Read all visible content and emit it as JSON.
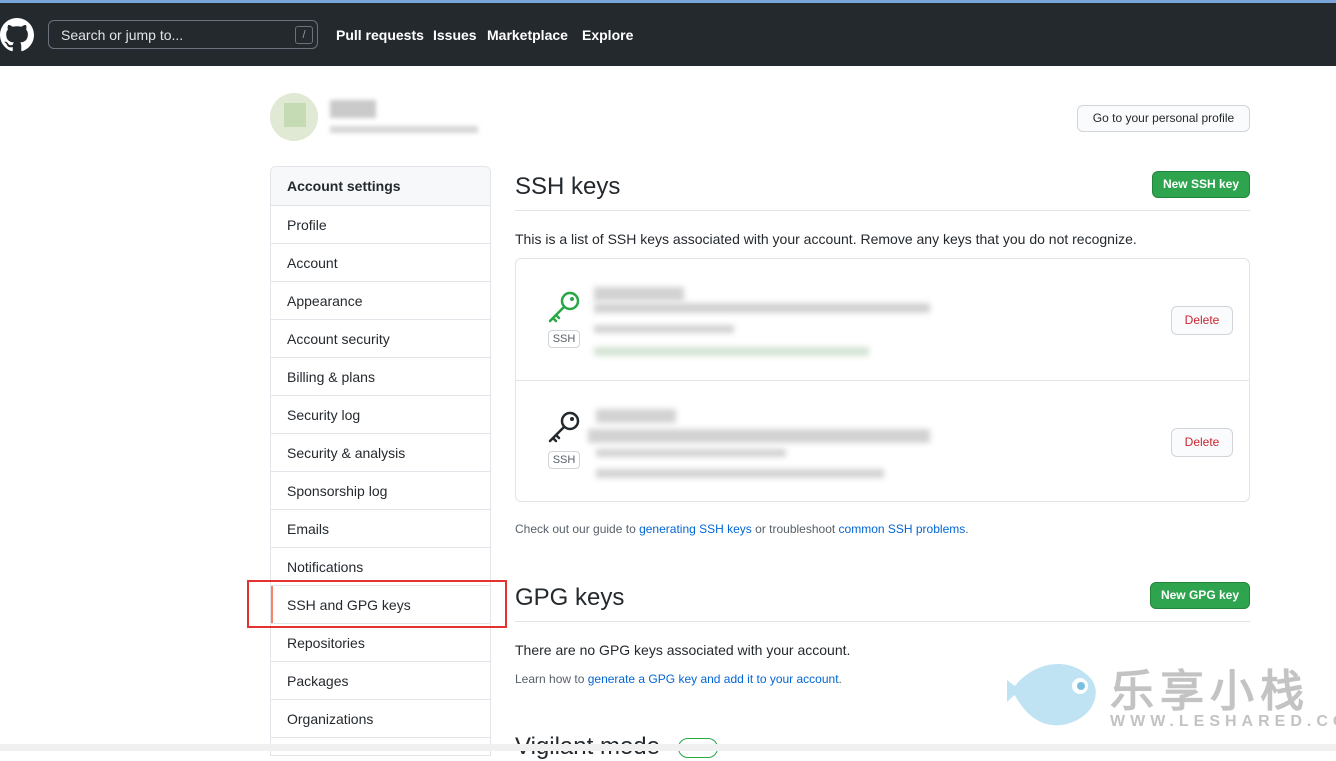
{
  "header": {
    "search_placeholder": "Search or jump to...",
    "search_shortcut": "/",
    "nav": [
      "Pull requests",
      "Issues",
      "Marketplace",
      "Explore"
    ]
  },
  "profile_button": "Go to your personal profile",
  "menu": {
    "heading": "Account settings",
    "items": [
      "Profile",
      "Account",
      "Appearance",
      "Account security",
      "Billing & plans",
      "Security log",
      "Security & analysis",
      "Sponsorship log",
      "Emails",
      "Notifications",
      "SSH and GPG keys",
      "Repositories",
      "Packages",
      "Organizations"
    ],
    "selected": "SSH and GPG keys"
  },
  "ssh": {
    "title": "SSH keys",
    "new_button": "New SSH key",
    "description": "This is a list of SSH keys associated with your account. Remove any keys that you do not recognize.",
    "keys": [
      {
        "type": "SSH",
        "delete_label": "Delete",
        "status_color": "#28a745"
      },
      {
        "type": "SSH",
        "delete_label": "Delete",
        "status_color": "#24292e"
      }
    ],
    "guide_prefix": "Check out our guide to ",
    "guide_link1": "generating SSH keys",
    "guide_middle": " or troubleshoot ",
    "guide_link2": "common SSH problems",
    "guide_suffix": "."
  },
  "gpg": {
    "title": "GPG keys",
    "new_button": "New GPG key",
    "empty": "There are no GPG keys associated with your account.",
    "learn_prefix": "Learn how to ",
    "learn_link": "generate a GPG key and add it to your account",
    "learn_suffix": "."
  },
  "vigilant_title": "Vigilant mode",
  "watermark": {
    "text": "乐享小栈",
    "url": "WWW.LESHARED.COM"
  }
}
